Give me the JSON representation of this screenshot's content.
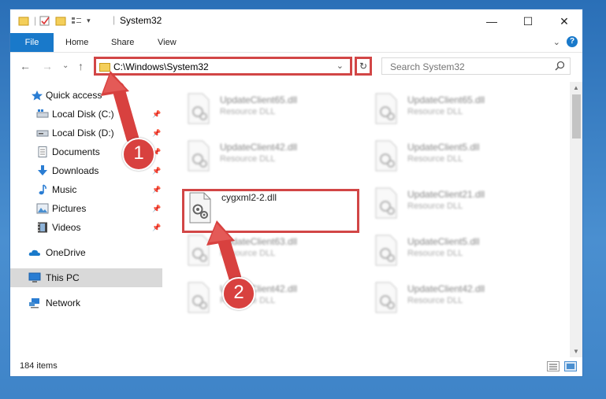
{
  "window": {
    "title": "System32",
    "controls": {
      "minimize": "—",
      "maximize": "☐",
      "close": "✕"
    }
  },
  "ribbon": {
    "tabs": [
      "File",
      "Home",
      "Share",
      "View"
    ],
    "help": "?",
    "collapse": "⌄"
  },
  "navigation": {
    "back": "←",
    "forward": "→",
    "recent": "⌄",
    "up": "↑",
    "address": "C:\\Windows\\System32",
    "address_dropdown": "⌄",
    "refresh": "↻",
    "search_placeholder": "Search System32",
    "search_icon": "magnifier-icon"
  },
  "sidebar": {
    "items": [
      {
        "label": "Quick access",
        "icon": "star-icon",
        "pinned": false
      },
      {
        "label": "Local Disk (C:)",
        "icon": "drive-icon",
        "pinned": true
      },
      {
        "label": "Local Disk (D:)",
        "icon": "drive-icon",
        "pinned": true
      },
      {
        "label": "Documents",
        "icon": "document-icon",
        "pinned": true
      },
      {
        "label": "Downloads",
        "icon": "download-icon",
        "pinned": true
      },
      {
        "label": "Music",
        "icon": "music-icon",
        "pinned": true
      },
      {
        "label": "Pictures",
        "icon": "pictures-icon",
        "pinned": true
      },
      {
        "label": "Videos",
        "icon": "videos-icon",
        "pinned": true
      },
      {
        "label": "OneDrive",
        "icon": "cloud-icon",
        "pinned": false
      },
      {
        "label": "This PC",
        "icon": "computer-icon",
        "pinned": false,
        "selected": true
      },
      {
        "label": "Network",
        "icon": "network-icon",
        "pinned": false
      }
    ]
  },
  "files": [
    {
      "name": "UpdateClient65.dll",
      "type": "Resource DLL"
    },
    {
      "name": "UpdateClient65.dll",
      "type": "Resource DLL"
    },
    {
      "name": "UpdateClient42.dll",
      "type": "Resource DLL"
    },
    {
      "name": "UpdateClient5.dll",
      "type": "Resource DLL"
    },
    {
      "name": "cygxml2-2.dll",
      "type": ""
    },
    {
      "name": "UpdateClient21.dll",
      "type": "Resource DLL"
    },
    {
      "name": "UpdateClient63.dll",
      "type": "Resource DLL"
    },
    {
      "name": "UpdateClient5.dll",
      "type": "Resource DLL"
    },
    {
      "name": "UpdateClient42.dll",
      "type": "Resource DLL"
    },
    {
      "name": "UpdateClient42.dll",
      "type": "Resource DLL"
    }
  ],
  "status": {
    "item_count": "184 items"
  },
  "callouts": [
    "1",
    "2"
  ],
  "colors": {
    "accent": "#1979ca",
    "highlight": "#d24646",
    "selected": "#d9d9d9"
  }
}
